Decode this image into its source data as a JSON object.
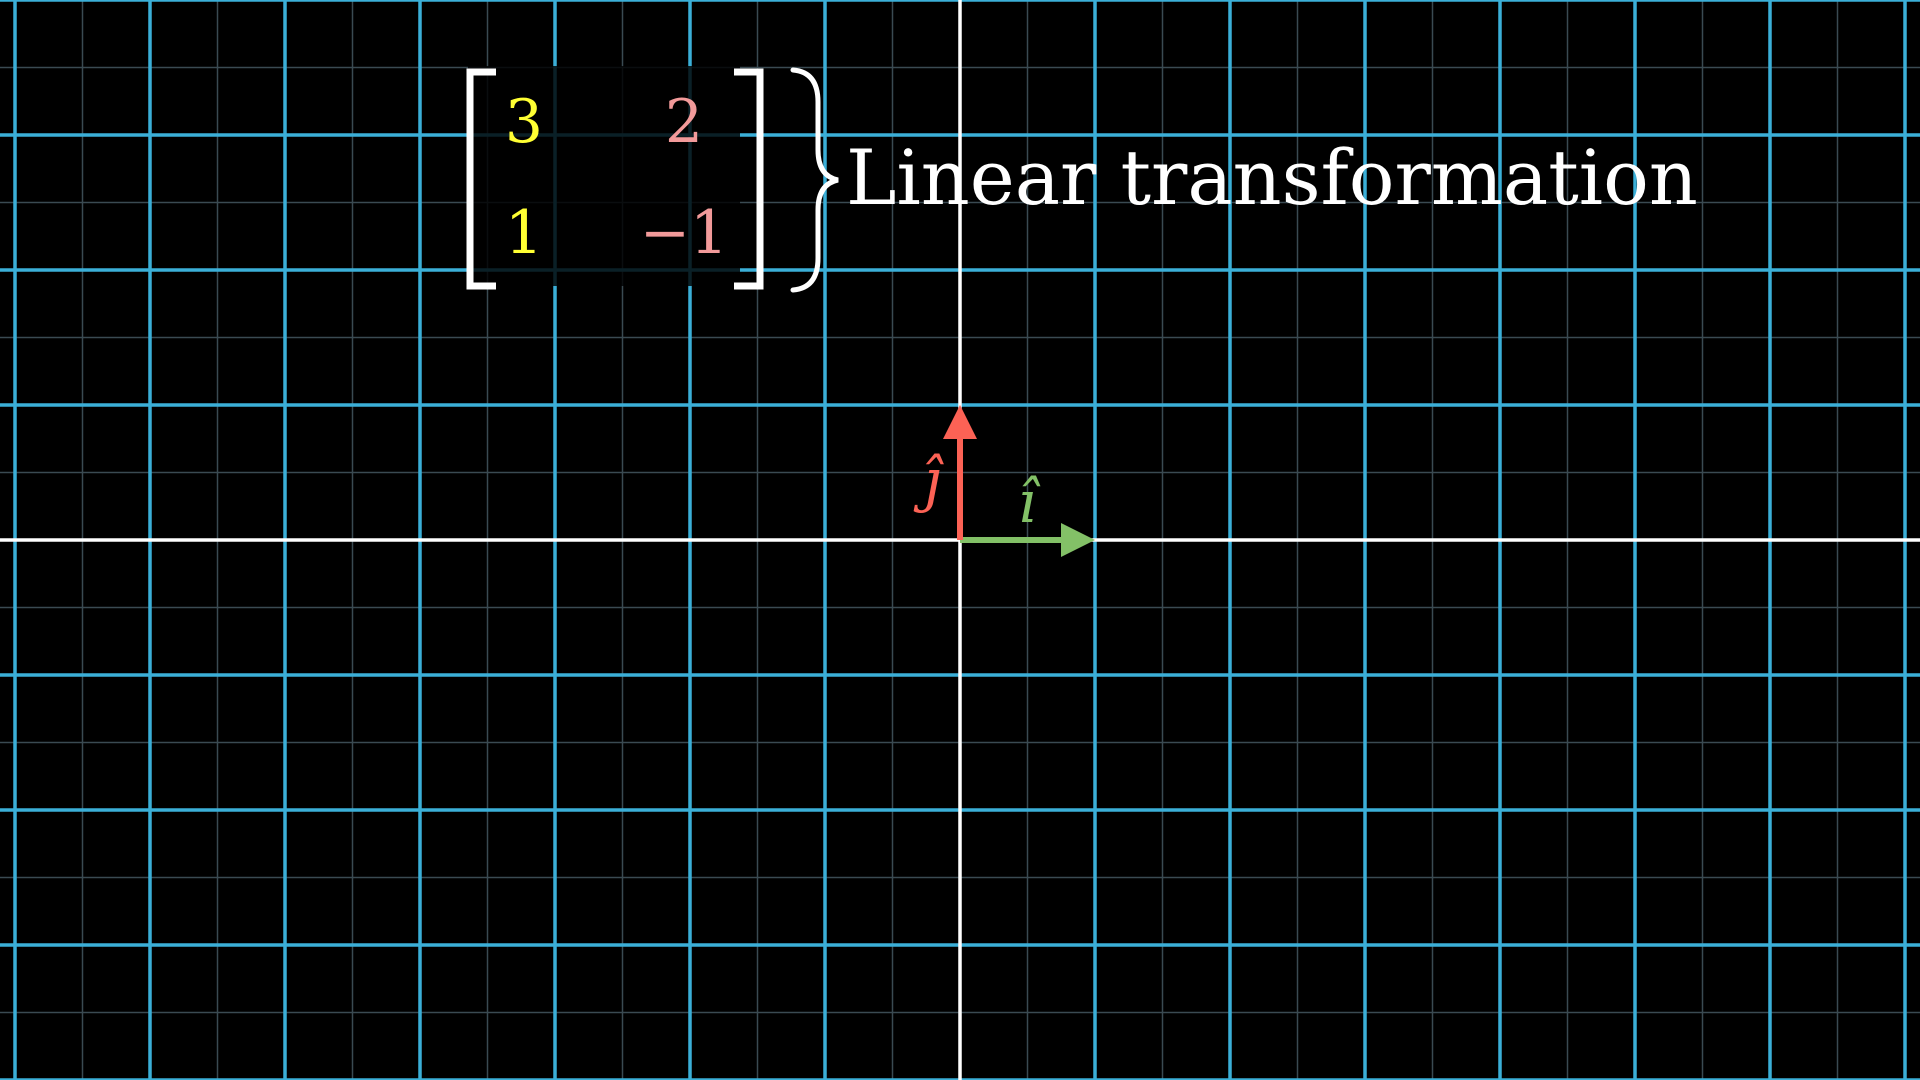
{
  "scene": {
    "title": "Linear transformation",
    "colors": {
      "background": "#000000",
      "axis": "#ffffff",
      "major_grid": "#3bafd8",
      "minor_grid": "#3a4a52",
      "matrix_column_1": "#ffff33",
      "matrix_column_2": "#f29a9a",
      "i_hat": "#83c167",
      "j_hat": "#fc6255",
      "bracket": "#ffffff",
      "title": "#ffffff"
    },
    "matrix": {
      "rows": [
        [
          "3",
          "2"
        ],
        [
          "1",
          "−1"
        ]
      ]
    },
    "basis_vectors": {
      "i_hat": {
        "label": "î",
        "x": 1,
        "y": 0,
        "color_key": "i_hat"
      },
      "j_hat": {
        "label": "ĵ",
        "x": 0,
        "y": 1,
        "color_key": "j_hat"
      }
    }
  }
}
